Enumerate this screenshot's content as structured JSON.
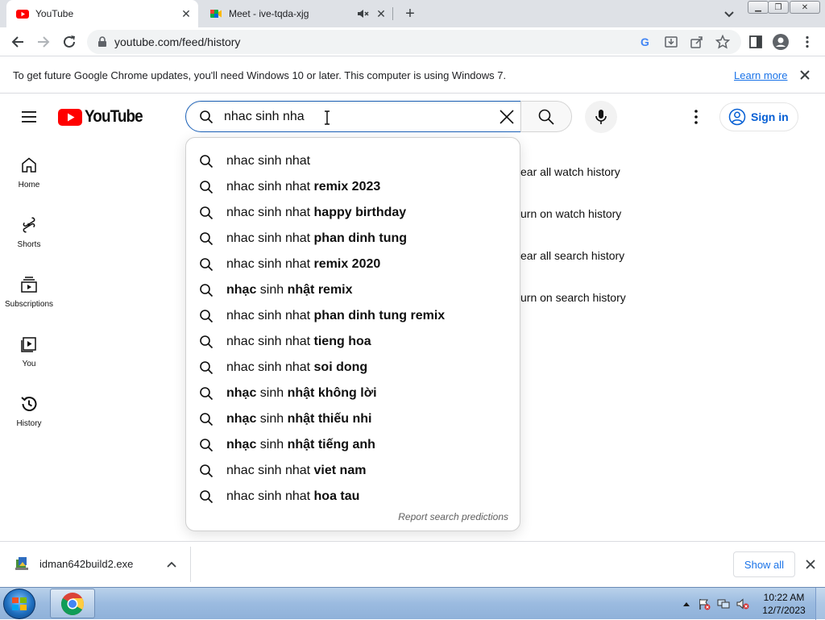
{
  "browser": {
    "tabs": [
      {
        "title": "YouTube",
        "active": true
      },
      {
        "title": "Meet - ive-tqda-xjg",
        "active": false
      }
    ],
    "url": "youtube.com/feed/history"
  },
  "infobar": {
    "message": "To get future Google Chrome updates, you'll need Windows 10 or later. This computer is using Windows 7.",
    "link": "Learn more"
  },
  "youtube": {
    "logo_text": "YouTube",
    "search_query": "nhac sinh nha",
    "sign_in": "Sign in",
    "sidebar": [
      {
        "label": "Home",
        "icon": "home-icon"
      },
      {
        "label": "Shorts",
        "icon": "shorts-icon"
      },
      {
        "label": "Subscriptions",
        "icon": "subscriptions-icon"
      },
      {
        "label": "You",
        "icon": "you-icon"
      },
      {
        "label": "History",
        "icon": "history-icon"
      }
    ],
    "history_options": [
      "ear all watch history",
      "urn on watch history",
      "ear all search history",
      "urn on search history"
    ],
    "suggestions": [
      {
        "plain": "nhac sinh nhat",
        "bold": ""
      },
      {
        "plain": "nhac sinh nhat",
        "bold": " remix 2023"
      },
      {
        "plain": "nhac sinh nhat",
        "bold": " happy birthday"
      },
      {
        "plain": "nhac sinh nhat",
        "bold": " phan dinh tung"
      },
      {
        "plain": "nhac sinh nhat",
        "bold": " remix 2020"
      },
      {
        "pre_bold": "nhạc",
        "plain": " sinh ",
        "bold": "nhật remix"
      },
      {
        "plain": "nhac sinh nhat",
        "bold": " phan dinh tung remix"
      },
      {
        "plain": "nhac sinh nhat",
        "bold": " tieng hoa"
      },
      {
        "plain": "nhac sinh nhat",
        "bold": " soi dong"
      },
      {
        "pre_bold": "nhạc",
        "plain": " sinh ",
        "bold": "nhật không lời"
      },
      {
        "pre_bold": "nhạc",
        "plain": " sinh ",
        "bold": "nhật thiếu nhi"
      },
      {
        "pre_bold": "nhạc",
        "plain": " sinh ",
        "bold": "nhật tiếng anh"
      },
      {
        "plain": "nhac sinh nhat",
        "bold": " viet nam"
      },
      {
        "plain": "nhac sinh nhat",
        "bold": " hoa tau"
      }
    ],
    "report_link": "Report search predictions"
  },
  "downloads": {
    "file_name": "idman642build2.exe",
    "show_all": "Show all"
  },
  "taskbar": {
    "time": "10:22 AM",
    "date": "12/7/2023"
  },
  "colors": {
    "youtube_red": "#ff0000",
    "link_blue": "#065fd4",
    "chrome_blue": "#1a73e8"
  }
}
